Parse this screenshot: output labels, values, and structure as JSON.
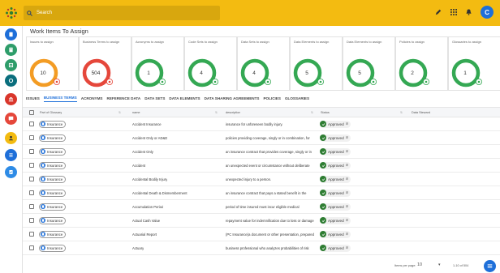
{
  "header": {
    "search_placeholder": "Search",
    "user_initial": "C",
    "icons": [
      "logo-icon",
      "search-icon",
      "pencil-icon",
      "grid-apps-icon",
      "bell-icon"
    ]
  },
  "sidebar": {
    "items": [
      {
        "icon": "document-icon",
        "color": "#1e6fd9"
      },
      {
        "icon": "book-icon",
        "color": "#2e9d6a"
      },
      {
        "icon": "stack-icon",
        "color": "#2e9d6a"
      },
      {
        "icon": "circle-icon",
        "color": "#0a6e7d"
      },
      {
        "icon": "bank-icon",
        "color": "#d9362b"
      },
      {
        "icon": "chat-icon",
        "color": "#e5473b"
      },
      {
        "icon": "person-icon",
        "color": "#f3bb11"
      },
      {
        "icon": "list-icon",
        "color": "#1e6fd9"
      },
      {
        "icon": "checklist-icon",
        "color": "#2e8be6"
      }
    ]
  },
  "page": {
    "title": "Work Items To Assign"
  },
  "cards": [
    {
      "label": "Issues to assign",
      "value": "10",
      "color": "#f39c24",
      "badge": "#e5473b"
    },
    {
      "label": "Business Terms to assign",
      "value": "504",
      "color": "#e5473b",
      "badge": "#e5473b"
    },
    {
      "label": "Acronyms to assign",
      "value": "1",
      "color": "#34a853",
      "badge": "#34a853"
    },
    {
      "label": "Code Sets to assign",
      "value": "4",
      "color": "#34a853",
      "badge": "#34a853"
    },
    {
      "label": "Data Sets to assign",
      "value": "4",
      "color": "#34a853",
      "badge": "#34a853"
    },
    {
      "label": "Data Elements to assign",
      "value": "5",
      "color": "#34a853",
      "badge": "#34a853"
    },
    {
      "label": "Data Elements to assign",
      "value": "5",
      "color": "#34a853",
      "badge": "#34a853"
    },
    {
      "label": "Policies to assign",
      "value": "2",
      "color": "#34a853",
      "badge": "#34a853"
    },
    {
      "label": "Glossaries to assign",
      "value": "1",
      "color": "#34a853",
      "badge": "#34a853"
    }
  ],
  "tabs": [
    "ISSUES",
    "BUSINESS TERMS",
    "ACRONYMS",
    "REFERENCE DATA",
    "DATA SETS",
    "DATA ELEMENTS",
    "DATA SHARING AGREEMENTS",
    "POLICIES",
    "GLOSSARIES"
  ],
  "active_tab": "BUSINESS TERMS",
  "table": {
    "columns": [
      "Part of Glossary",
      "name",
      "description",
      "Status",
      "Data Steward"
    ],
    "rows": [
      {
        "glossary": "Insurance",
        "name": "Accident Insurance",
        "description": "insurance for unforeseen bodily injury.",
        "status": "Approved"
      },
      {
        "glossary": "Insurance",
        "name": "Accident Only or AD&D",
        "description": "policies providing coverage, singly or in combination, for",
        "status": "Approved"
      },
      {
        "glossary": "Insurance",
        "name": "Accident Only",
        "description": "an insurance contract that provides coverage, singly or in",
        "status": "Approved"
      },
      {
        "glossary": "Insurance",
        "name": "Accident",
        "description": "an unexpected event or circumstance without deliberate",
        "status": "Approved"
      },
      {
        "glossary": "Insurance",
        "name": "Accidental Bodily Injury",
        "description": "unexpected injury to a person.",
        "status": "Approved"
      },
      {
        "glossary": "Insurance",
        "name": "Accidental Death & Dismemberment",
        "description": "an insurance contract that pays a stated benefit in the",
        "status": "Approved"
      },
      {
        "glossary": "Insurance",
        "name": "Accumulation Period",
        "description": "period of time insured must incur eligible medical",
        "status": "Approved"
      },
      {
        "glossary": "Insurance",
        "name": "Actual Cash Value",
        "description": "repayment value for indemnification due to loss or damage",
        "status": "Approved"
      },
      {
        "glossary": "Insurance",
        "name": "Actuarial Report",
        "description": "(PC Insurance)a document or other presentation, prepared",
        "status": "Approved"
      },
      {
        "glossary": "Insurance",
        "name": "Actuary",
        "description": "business professional who analyzes probabilities of risk",
        "status": "Approved"
      }
    ]
  },
  "pagination": {
    "per_page_label": "Items per page:",
    "per_page": "10",
    "range": "1-10 of 504"
  }
}
